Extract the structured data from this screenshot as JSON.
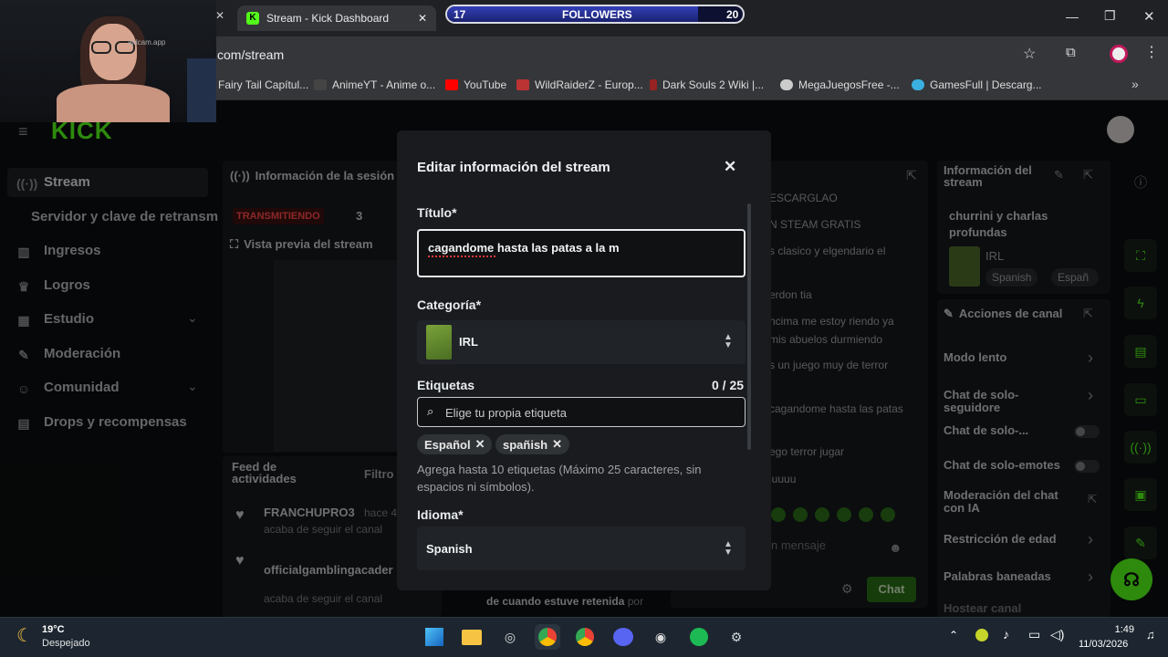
{
  "browser": {
    "tab_title": "Stream - Kick Dashboard",
    "address": "com/stream",
    "followers_widget": {
      "left": "17",
      "label": "FOLLOWERS",
      "right": "20"
    },
    "bookmarks": [
      {
        "label": "Fairy Tail Capítul...",
        "color": "#8a6f3c"
      },
      {
        "label": "AnimeYT - Anime o...",
        "color": "#444"
      },
      {
        "label": "YouTube",
        "color": "#ff0000"
      },
      {
        "label": "WildRaiderZ - Europ...",
        "color": "#b33"
      },
      {
        "label": "Dark Souls 2 Wiki |...",
        "color": "#922"
      },
      {
        "label": "MegaJuegosFree -...",
        "color": "#ccc"
      },
      {
        "label": "GamesFull | Descarg...",
        "color": "#3ab0e0"
      }
    ]
  },
  "webcam_watermark": "aidcam.app",
  "sidebar": {
    "logo": "KICK",
    "items": [
      {
        "label": "Stream",
        "icon": "broadcast-icon"
      },
      {
        "label": "Servidor y clave de retransm",
        "icon": ""
      },
      {
        "label": "Ingresos",
        "icon": "chart-icon"
      },
      {
        "label": "Logros",
        "icon": "trophy-icon"
      },
      {
        "label": "Estudio",
        "icon": "studio-icon"
      },
      {
        "label": "Moderación",
        "icon": "wrench-icon"
      },
      {
        "label": "Comunidad",
        "icon": "people-icon"
      },
      {
        "label": "Drops y recompensas",
        "icon": "gift-icon"
      }
    ]
  },
  "session_panel": {
    "title": "Información de la sesión",
    "status": "TRANSMITIENDO",
    "count": "3",
    "preview_title": "Vista previa del stream"
  },
  "activity": {
    "title": "Feed de actividades",
    "filter": "Filtro",
    "entries": [
      {
        "name": "FRANCHUPRO3",
        "time": "hace 4",
        "text": "acaba de seguir el canal"
      },
      {
        "name": "officialgamblingacader",
        "time": "",
        "text": "acaba de seguir el canal"
      }
    ],
    "bottom_text": "de cuando estuve retenida",
    "bottom_by": "por"
  },
  "chat": {
    "messages": [
      "ESCARGLAO",
      "N STEAM GRATIS",
      "s clasico y elgendario el",
      "erdon tia",
      "ncima me estoy riendo ya",
      "mis abuelos durmiendo",
      "s un juego muy de terror",
      "cagandome hasta las patas",
      "ego terror jugar",
      "luuuu"
    ],
    "input_placeholder": "n mensaje",
    "send_label": "Chat"
  },
  "stream_info_panel": {
    "title": "Información del stream",
    "stream_title": "churrini y charlas profundas",
    "category": "IRL",
    "tags": [
      "Spanish",
      "Españ"
    ]
  },
  "channel_actions": {
    "title": "Acciones de canal",
    "items": [
      {
        "label": "Modo lento",
        "control": "chevron"
      },
      {
        "label": "Chat de solo-seguidore",
        "control": "chevron"
      },
      {
        "label": "Chat de solo-...",
        "control": "toggle"
      },
      {
        "label": "Chat de solo-emotes",
        "control": "toggle"
      },
      {
        "label": "Moderación del chat con IA",
        "control": "external"
      },
      {
        "label": "Restricción de edad",
        "control": "chevron"
      },
      {
        "label": "Palabras baneadas",
        "control": "chevron"
      },
      {
        "label": "Hostear canal",
        "control": ""
      }
    ]
  },
  "modal": {
    "title": "Editar información del stream",
    "title_label": "Título*",
    "title_value": "cagandome hasta las patas a la m",
    "category_label": "Categoría*",
    "category_value": "IRL",
    "tags_label": "Etiquetas",
    "tags_count": "0 / 25",
    "tags_placeholder": "Elige tu propia etiqueta",
    "chips": [
      "Español",
      "spañish"
    ],
    "tags_help": "Agrega hasta 10 etiquetas (Máximo 25 caracteres, sin espacios ni símbolos).",
    "language_label": "Idioma*",
    "language_value": "Spanish"
  },
  "taskbar": {
    "weather_temp": "19°C",
    "weather_desc": "Despejado",
    "time": "1:49",
    "date": "11/03/2026"
  },
  "colors": {
    "accent": "#53fc18",
    "live": "#e91916",
    "modal_bg": "#191b1f"
  }
}
